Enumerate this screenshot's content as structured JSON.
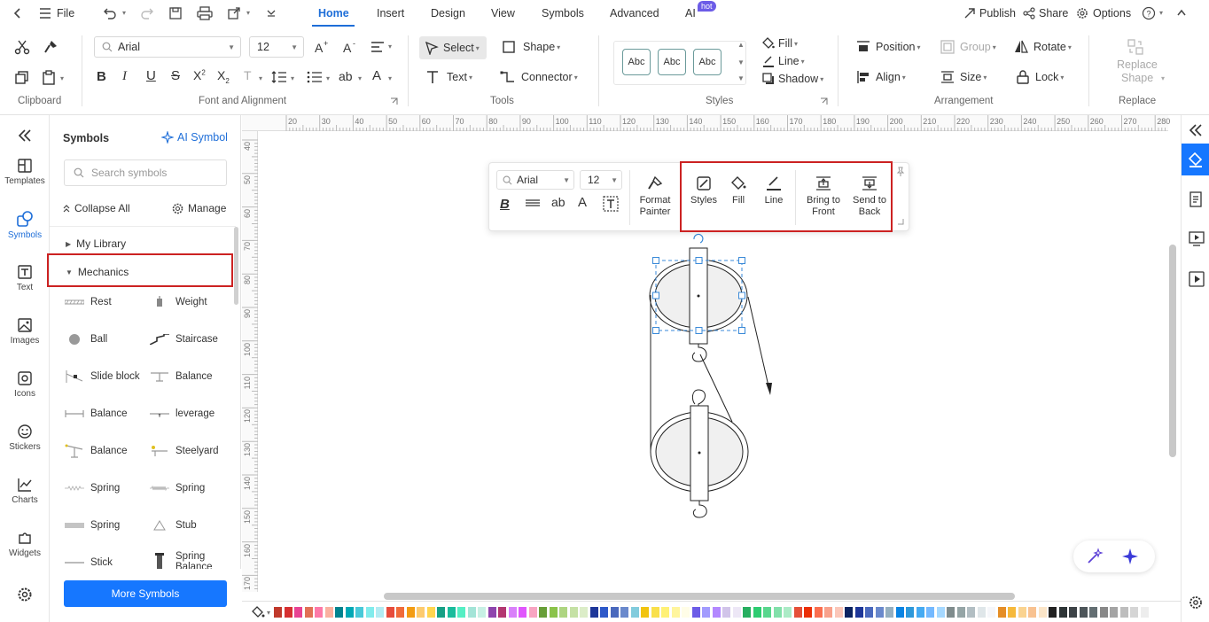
{
  "menubar": {
    "file": "File",
    "tabs": [
      "Home",
      "Insert",
      "Design",
      "View",
      "Symbols",
      "Advanced",
      "AI"
    ],
    "hot_badge": "hot",
    "publish": "Publish",
    "share": "Share",
    "options": "Options"
  },
  "ribbon": {
    "clipboard_label": "Clipboard",
    "font_label": "Font and Alignment",
    "tools_label": "Tools",
    "styles_label": "Styles",
    "arrangement_label": "Arrangement",
    "replace_label": "Replace",
    "font_name": "Arial",
    "font_size": "12",
    "select": "Select",
    "shape": "Shape",
    "text": "Text",
    "connector": "Connector",
    "style_sample": "Abc",
    "fill": "Fill",
    "line": "Line",
    "shadow": "Shadow",
    "position": "Position",
    "group": "Group",
    "rotate": "Rotate",
    "align": "Align",
    "size": "Size",
    "lock": "Lock",
    "replace_shape_1": "Replace",
    "replace_shape_2": "Shape"
  },
  "leftbar": {
    "items": [
      "Templates",
      "Symbols",
      "Text",
      "Images",
      "Icons",
      "Stickers",
      "Charts",
      "Widgets"
    ]
  },
  "symbols": {
    "title": "Symbols",
    "ai_symbol": "AI Symbol",
    "search_placeholder": "Search symbols",
    "collapse_all": "Collapse All",
    "manage": "Manage",
    "my_library": "My Library",
    "mechanics": "Mechanics",
    "items": [
      "Rest",
      "Weight",
      "Ball",
      "Staircase",
      "Slide block",
      "Balance",
      "Balance",
      "leverage",
      "Balance",
      "Steelyard",
      "Spring",
      "Spring",
      "Spring",
      "Stub",
      "Stick",
      "Spring Balance"
    ],
    "more_symbols": "More Symbols"
  },
  "ruler": {
    "top": [
      "20",
      "30",
      "40",
      "50",
      "60",
      "70",
      "80",
      "90",
      "100",
      "110",
      "120",
      "130",
      "140",
      "150",
      "160",
      "170",
      "180",
      "190",
      "200",
      "210",
      "220",
      "230",
      "240",
      "250",
      "260",
      "270",
      "280"
    ],
    "left": [
      "40",
      "50",
      "60",
      "70",
      "80",
      "90",
      "100",
      "110",
      "120",
      "130",
      "140",
      "150",
      "160",
      "170"
    ]
  },
  "floatbar": {
    "font_name": "Arial",
    "font_size": "12",
    "format_painter_1": "Format",
    "format_painter_2": "Painter",
    "styles": "Styles",
    "fill": "Fill",
    "line": "Line",
    "bring_front_1": "Bring to",
    "bring_front_2": "Front",
    "send_back_1": "Send to",
    "send_back_2": "Back"
  },
  "colors": {
    "accent": "#1e6ed8",
    "highlight": "#cc2222",
    "swatches": [
      "#c0392b",
      "#d63031",
      "#e84393",
      "#e17055",
      "#fd79a8",
      "#fab1a0",
      "#00838f",
      "#00a8b5",
      "#48c9d8",
      "#81ecec",
      "#b2ebf2",
      "#e74c3c",
      "#f06b3a",
      "#f39c12",
      "#fdcb6e",
      "#ffd54f",
      "#16a085",
      "#1abc9c",
      "#55efc4",
      "#a3e4d7",
      "#c7f0e4",
      "#8e44ad",
      "#b33771",
      "#d980fa",
      "#e056fd",
      "#f8a5c2",
      "#689f38",
      "#8bc34a",
      "#aed581",
      "#c5e1a5",
      "#dcedc8",
      "#1e3799",
      "#2e59c9",
      "#4a69bd",
      "#6a89cc",
      "#82ccdd",
      "#f1c40f",
      "#f9e04b",
      "#fff176",
      "#fff59d",
      "#fffde7",
      "#6c5ce7",
      "#a29bfe",
      "#b388ff",
      "#d1c4e9",
      "#ede7f6",
      "#27ae60",
      "#2ecc71",
      "#58d68d",
      "#82e0aa",
      "#abebc6",
      "#e55039",
      "#eb2f06",
      "#fa6e4f",
      "#f8a18b",
      "#fbc7b9",
      "#0c2461",
      "#1e3799",
      "#4a69bd",
      "#6a89cc",
      "#95afc0",
      "#0984e3",
      "#2d98da",
      "#45aaf2",
      "#74b9ff",
      "#a5d8ff",
      "#7f8c8d",
      "#95a5a6",
      "#b2bec3",
      "#dfe6e9",
      "#f5f6fa",
      "#e58e26",
      "#f6b93b",
      "#fad390",
      "#f8c291",
      "#fbe5c8",
      "#222222",
      "#2d3436",
      "#3d4347",
      "#4d5559",
      "#636e72",
      "#888888",
      "#a4a4a4",
      "#bdbdbd",
      "#d5d5d5",
      "#ededed"
    ]
  }
}
